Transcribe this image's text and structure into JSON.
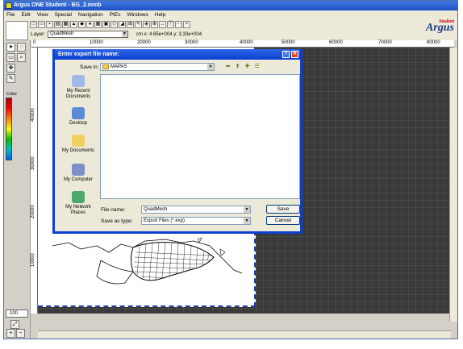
{
  "window": {
    "title": "Argus ONE Student - BG_2.mmb"
  },
  "menu": [
    "File",
    "Edit",
    "View",
    "Special",
    "Navigation",
    "PIEs",
    "Windows",
    "Help"
  ],
  "toolbar": {
    "layer_label": "Layer:",
    "layer_value": "QuadMesh",
    "coordinates": "cm x: 4.65e+004 y: 3.33e+004"
  },
  "logo": {
    "main": "Argus",
    "sub": "Student"
  },
  "left_panel": {
    "color_label": "Color",
    "zoom_value": "100"
  },
  "ruler": {
    "top": [
      "0",
      "10000",
      "20000",
      "30000",
      "40000",
      "50000",
      "60000",
      "70000",
      "80000"
    ],
    "left": [
      "40000",
      "30000",
      "20000",
      "10000"
    ]
  },
  "dialog": {
    "title": "Enter export file name:",
    "save_in_label": "Save in:",
    "save_in_value": "MAPAS",
    "places": [
      "My Recent Documents",
      "Desktop",
      "My Documents",
      "My Computer",
      "My Network Places"
    ],
    "file_name_label": "File name:",
    "file_name_value": "QuadMesh",
    "save_as_type_label": "Save as type:",
    "save_as_type_value": "Export Files (*.exp)",
    "save_button": "Save",
    "cancel_button": "Cancel",
    "help_glyph": "?",
    "close_glyph": "✕"
  }
}
